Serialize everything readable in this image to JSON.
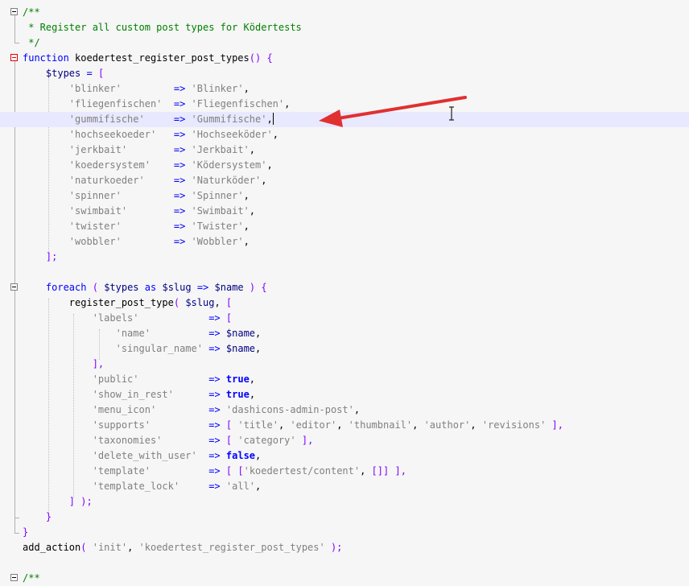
{
  "editor": {
    "language": "php",
    "current_line": 7,
    "lines": [
      [
        {
          "t": "/**",
          "c": "comment"
        }
      ],
      [
        {
          "t": " * Register all custom post types for Ködertests",
          "c": "comment"
        }
      ],
      [
        {
          "t": " */",
          "c": "comment"
        }
      ],
      [
        {
          "t": "function",
          "c": "keyword"
        },
        {
          "t": " koedertest_register_post_types",
          "c": "default"
        },
        {
          "t": "()",
          "c": "bracket"
        },
        {
          "t": " ",
          "c": "default"
        },
        {
          "t": "{",
          "c": "bracket"
        }
      ],
      [
        {
          "t": "    ",
          "c": "default"
        },
        {
          "t": "$types",
          "c": "variable"
        },
        {
          "t": " ",
          "c": "default"
        },
        {
          "t": "=",
          "c": "operator"
        },
        {
          "t": " ",
          "c": "default"
        },
        {
          "t": "[",
          "c": "bracket"
        }
      ],
      [
        {
          "t": "        ",
          "c": "default"
        },
        {
          "t": "'blinker'",
          "c": "string"
        },
        {
          "t": "         ",
          "c": "default"
        },
        {
          "t": "=>",
          "c": "operator"
        },
        {
          "t": " ",
          "c": "default"
        },
        {
          "t": "'Blinker'",
          "c": "string"
        },
        {
          "t": ",",
          "c": "default"
        }
      ],
      [
        {
          "t": "        ",
          "c": "default"
        },
        {
          "t": "'fliegenfischen'",
          "c": "string"
        },
        {
          "t": "  ",
          "c": "default"
        },
        {
          "t": "=>",
          "c": "operator"
        },
        {
          "t": " ",
          "c": "default"
        },
        {
          "t": "'Fliegenfischen'",
          "c": "string"
        },
        {
          "t": ",",
          "c": "default"
        }
      ],
      [
        {
          "t": "        ",
          "c": "default"
        },
        {
          "t": "'gummifische'",
          "c": "string"
        },
        {
          "t": "     ",
          "c": "default"
        },
        {
          "t": "=>",
          "c": "operator"
        },
        {
          "t": " ",
          "c": "default"
        },
        {
          "t": "'Gummifische'",
          "c": "string"
        },
        {
          "t": ",",
          "c": "default"
        },
        {
          "t": "",
          "c": "caret"
        }
      ],
      [
        {
          "t": "        ",
          "c": "default"
        },
        {
          "t": "'hochseekoeder'",
          "c": "string"
        },
        {
          "t": "   ",
          "c": "default"
        },
        {
          "t": "=>",
          "c": "operator"
        },
        {
          "t": " ",
          "c": "default"
        },
        {
          "t": "'Hochseeköder'",
          "c": "string"
        },
        {
          "t": ",",
          "c": "default"
        }
      ],
      [
        {
          "t": "        ",
          "c": "default"
        },
        {
          "t": "'jerkbait'",
          "c": "string"
        },
        {
          "t": "        ",
          "c": "default"
        },
        {
          "t": "=>",
          "c": "operator"
        },
        {
          "t": " ",
          "c": "default"
        },
        {
          "t": "'Jerkbait'",
          "c": "string"
        },
        {
          "t": ",",
          "c": "default"
        }
      ],
      [
        {
          "t": "        ",
          "c": "default"
        },
        {
          "t": "'koedersystem'",
          "c": "string"
        },
        {
          "t": "    ",
          "c": "default"
        },
        {
          "t": "=>",
          "c": "operator"
        },
        {
          "t": " ",
          "c": "default"
        },
        {
          "t": "'Ködersystem'",
          "c": "string"
        },
        {
          "t": ",",
          "c": "default"
        }
      ],
      [
        {
          "t": "        ",
          "c": "default"
        },
        {
          "t": "'naturkoeder'",
          "c": "string"
        },
        {
          "t": "     ",
          "c": "default"
        },
        {
          "t": "=>",
          "c": "operator"
        },
        {
          "t": " ",
          "c": "default"
        },
        {
          "t": "'Naturköder'",
          "c": "string"
        },
        {
          "t": ",",
          "c": "default"
        }
      ],
      [
        {
          "t": "        ",
          "c": "default"
        },
        {
          "t": "'spinner'",
          "c": "string"
        },
        {
          "t": "         ",
          "c": "default"
        },
        {
          "t": "=>",
          "c": "operator"
        },
        {
          "t": " ",
          "c": "default"
        },
        {
          "t": "'Spinner'",
          "c": "string"
        },
        {
          "t": ",",
          "c": "default"
        }
      ],
      [
        {
          "t": "        ",
          "c": "default"
        },
        {
          "t": "'swimbait'",
          "c": "string"
        },
        {
          "t": "        ",
          "c": "default"
        },
        {
          "t": "=>",
          "c": "operator"
        },
        {
          "t": " ",
          "c": "default"
        },
        {
          "t": "'Swimbait'",
          "c": "string"
        },
        {
          "t": ",",
          "c": "default"
        }
      ],
      [
        {
          "t": "        ",
          "c": "default"
        },
        {
          "t": "'twister'",
          "c": "string"
        },
        {
          "t": "         ",
          "c": "default"
        },
        {
          "t": "=>",
          "c": "operator"
        },
        {
          "t": " ",
          "c": "default"
        },
        {
          "t": "'Twister'",
          "c": "string"
        },
        {
          "t": ",",
          "c": "default"
        }
      ],
      [
        {
          "t": "        ",
          "c": "default"
        },
        {
          "t": "'wobbler'",
          "c": "string"
        },
        {
          "t": "         ",
          "c": "default"
        },
        {
          "t": "=>",
          "c": "operator"
        },
        {
          "t": " ",
          "c": "default"
        },
        {
          "t": "'Wobbler'",
          "c": "string"
        },
        {
          "t": ",",
          "c": "default"
        }
      ],
      [
        {
          "t": "    ",
          "c": "default"
        },
        {
          "t": "];",
          "c": "bracket"
        }
      ],
      [],
      [
        {
          "t": "    ",
          "c": "default"
        },
        {
          "t": "foreach",
          "c": "keyword"
        },
        {
          "t": " ",
          "c": "default"
        },
        {
          "t": "(",
          "c": "bracket"
        },
        {
          "t": " ",
          "c": "default"
        },
        {
          "t": "$types",
          "c": "variable"
        },
        {
          "t": " ",
          "c": "default"
        },
        {
          "t": "as",
          "c": "keyword"
        },
        {
          "t": " ",
          "c": "default"
        },
        {
          "t": "$slug",
          "c": "variable"
        },
        {
          "t": " ",
          "c": "default"
        },
        {
          "t": "=>",
          "c": "operator"
        },
        {
          "t": " ",
          "c": "default"
        },
        {
          "t": "$name",
          "c": "variable"
        },
        {
          "t": " ",
          "c": "default"
        },
        {
          "t": ")",
          "c": "bracket"
        },
        {
          "t": " ",
          "c": "default"
        },
        {
          "t": "{",
          "c": "bracket"
        }
      ],
      [
        {
          "t": "        register_post_type",
          "c": "default"
        },
        {
          "t": "(",
          "c": "bracket"
        },
        {
          "t": " ",
          "c": "default"
        },
        {
          "t": "$slug",
          "c": "variable"
        },
        {
          "t": ", ",
          "c": "default"
        },
        {
          "t": "[",
          "c": "bracket"
        }
      ],
      [
        {
          "t": "            ",
          "c": "default"
        },
        {
          "t": "'labels'",
          "c": "string"
        },
        {
          "t": "            ",
          "c": "default"
        },
        {
          "t": "=>",
          "c": "operator"
        },
        {
          "t": " ",
          "c": "default"
        },
        {
          "t": "[",
          "c": "bracket"
        }
      ],
      [
        {
          "t": "                ",
          "c": "default"
        },
        {
          "t": "'name'",
          "c": "string"
        },
        {
          "t": "          ",
          "c": "default"
        },
        {
          "t": "=>",
          "c": "operator"
        },
        {
          "t": " ",
          "c": "default"
        },
        {
          "t": "$name",
          "c": "variable"
        },
        {
          "t": ",",
          "c": "default"
        }
      ],
      [
        {
          "t": "                ",
          "c": "default"
        },
        {
          "t": "'singular_name'",
          "c": "string"
        },
        {
          "t": " ",
          "c": "default"
        },
        {
          "t": "=>",
          "c": "operator"
        },
        {
          "t": " ",
          "c": "default"
        },
        {
          "t": "$name",
          "c": "variable"
        },
        {
          "t": ",",
          "c": "default"
        }
      ],
      [
        {
          "t": "            ",
          "c": "default"
        },
        {
          "t": "],",
          "c": "bracket"
        }
      ],
      [
        {
          "t": "            ",
          "c": "default"
        },
        {
          "t": "'public'",
          "c": "string"
        },
        {
          "t": "            ",
          "c": "default"
        },
        {
          "t": "=>",
          "c": "operator"
        },
        {
          "t": " ",
          "c": "default"
        },
        {
          "t": "true",
          "c": "boolean"
        },
        {
          "t": ",",
          "c": "default"
        }
      ],
      [
        {
          "t": "            ",
          "c": "default"
        },
        {
          "t": "'show_in_rest'",
          "c": "string"
        },
        {
          "t": "      ",
          "c": "default"
        },
        {
          "t": "=>",
          "c": "operator"
        },
        {
          "t": " ",
          "c": "default"
        },
        {
          "t": "true",
          "c": "boolean"
        },
        {
          "t": ",",
          "c": "default"
        }
      ],
      [
        {
          "t": "            ",
          "c": "default"
        },
        {
          "t": "'menu_icon'",
          "c": "string"
        },
        {
          "t": "         ",
          "c": "default"
        },
        {
          "t": "=>",
          "c": "operator"
        },
        {
          "t": " ",
          "c": "default"
        },
        {
          "t": "'dashicons-admin-post'",
          "c": "string"
        },
        {
          "t": ",",
          "c": "default"
        }
      ],
      [
        {
          "t": "            ",
          "c": "default"
        },
        {
          "t": "'supports'",
          "c": "string"
        },
        {
          "t": "          ",
          "c": "default"
        },
        {
          "t": "=>",
          "c": "operator"
        },
        {
          "t": " ",
          "c": "default"
        },
        {
          "t": "[",
          "c": "bracket"
        },
        {
          "t": " ",
          "c": "default"
        },
        {
          "t": "'title'",
          "c": "string"
        },
        {
          "t": ", ",
          "c": "default"
        },
        {
          "t": "'editor'",
          "c": "string"
        },
        {
          "t": ", ",
          "c": "default"
        },
        {
          "t": "'thumbnail'",
          "c": "string"
        },
        {
          "t": ", ",
          "c": "default"
        },
        {
          "t": "'author'",
          "c": "string"
        },
        {
          "t": ", ",
          "c": "default"
        },
        {
          "t": "'revisions'",
          "c": "string"
        },
        {
          "t": " ",
          "c": "default"
        },
        {
          "t": "],",
          "c": "bracket"
        }
      ],
      [
        {
          "t": "            ",
          "c": "default"
        },
        {
          "t": "'taxonomies'",
          "c": "string"
        },
        {
          "t": "        ",
          "c": "default"
        },
        {
          "t": "=>",
          "c": "operator"
        },
        {
          "t": " ",
          "c": "default"
        },
        {
          "t": "[",
          "c": "bracket"
        },
        {
          "t": " ",
          "c": "default"
        },
        {
          "t": "'category'",
          "c": "string"
        },
        {
          "t": " ",
          "c": "default"
        },
        {
          "t": "],",
          "c": "bracket"
        }
      ],
      [
        {
          "t": "            ",
          "c": "default"
        },
        {
          "t": "'delete_with_user'",
          "c": "string"
        },
        {
          "t": "  ",
          "c": "default"
        },
        {
          "t": "=>",
          "c": "operator"
        },
        {
          "t": " ",
          "c": "default"
        },
        {
          "t": "false",
          "c": "boolean"
        },
        {
          "t": ",",
          "c": "default"
        }
      ],
      [
        {
          "t": "            ",
          "c": "default"
        },
        {
          "t": "'template'",
          "c": "string"
        },
        {
          "t": "          ",
          "c": "default"
        },
        {
          "t": "=>",
          "c": "operator"
        },
        {
          "t": " ",
          "c": "default"
        },
        {
          "t": "[",
          "c": "bracket"
        },
        {
          "t": " ",
          "c": "default"
        },
        {
          "t": "[",
          "c": "bracket"
        },
        {
          "t": "'koedertest/content'",
          "c": "string"
        },
        {
          "t": ", ",
          "c": "default"
        },
        {
          "t": "[]",
          "c": "bracket"
        },
        {
          "t": "]",
          "c": "bracket"
        },
        {
          "t": " ",
          "c": "default"
        },
        {
          "t": "],",
          "c": "bracket"
        }
      ],
      [
        {
          "t": "            ",
          "c": "default"
        },
        {
          "t": "'template_lock'",
          "c": "string"
        },
        {
          "t": "     ",
          "c": "default"
        },
        {
          "t": "=>",
          "c": "operator"
        },
        {
          "t": " ",
          "c": "default"
        },
        {
          "t": "'all'",
          "c": "string"
        },
        {
          "t": ",",
          "c": "default"
        }
      ],
      [
        {
          "t": "        ",
          "c": "default"
        },
        {
          "t": "]",
          "c": "bracket"
        },
        {
          "t": " ",
          "c": "default"
        },
        {
          "t": ");",
          "c": "bracket"
        }
      ],
      [
        {
          "t": "    ",
          "c": "default"
        },
        {
          "t": "}",
          "c": "bracket"
        }
      ],
      [
        {
          "t": "}",
          "c": "bracket"
        }
      ],
      [
        {
          "t": "add_action",
          "c": "default"
        },
        {
          "t": "(",
          "c": "bracket"
        },
        {
          "t": " ",
          "c": "default"
        },
        {
          "t": "'init'",
          "c": "string"
        },
        {
          "t": ", ",
          "c": "default"
        },
        {
          "t": "'koedertest_register_post_types'",
          "c": "string"
        },
        {
          "t": " ",
          "c": "default"
        },
        {
          "t": ");",
          "c": "bracket"
        }
      ],
      [],
      [
        {
          "t": "/**",
          "c": "comment"
        }
      ]
    ]
  },
  "annotation": {
    "arrow_color": "#e03030",
    "icon": "arrow-icon"
  },
  "mouse_cursor": {
    "icon": "text-cursor-icon"
  },
  "colors": {
    "background": "#f6f6f6",
    "current_line": "#e8e8ff",
    "comment": "#008000",
    "keyword": "#0000ff",
    "string": "#808080",
    "variable": "#000080",
    "bracket": "#8000ff",
    "fold_marker_active": "#e00000"
  }
}
